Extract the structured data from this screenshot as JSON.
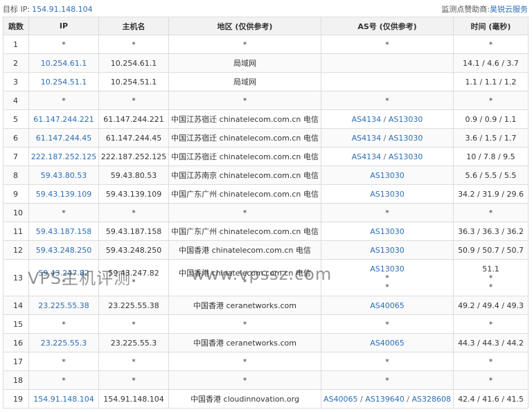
{
  "target": {
    "label": "目标 IP:",
    "ip": "154.91.148.104"
  },
  "sponsor": {
    "label": "监测点赞助商:",
    "name": "昊锐云服务"
  },
  "columns": [
    "跳数",
    "IP",
    "主机名",
    "地区 (仅供参考)",
    "AS号 (仅供参考)",
    "时间 (毫秒)"
  ],
  "rows": [
    {
      "hop": "1",
      "ip": "*",
      "host": "*",
      "region": "*",
      "as": [
        "*"
      ],
      "time": "*"
    },
    {
      "hop": "2",
      "ip": "10.254.61.1",
      "host": "10.254.61.1",
      "region": "局域网",
      "as": [],
      "time": "14.1 / 4.6 / 3.7"
    },
    {
      "hop": "3",
      "ip": "10.254.51.1",
      "host": "10.254.51.1",
      "region": "局域网",
      "as": [],
      "time": "1.1 / 1.1 / 1.2"
    },
    {
      "hop": "4",
      "ip": "*",
      "host": "*",
      "region": "*",
      "as": [
        "*"
      ],
      "time": "*"
    },
    {
      "hop": "5",
      "ip": "61.147.244.221",
      "host": "61.147.244.221",
      "region": "中国江苏宿迁 chinatelecom.com.cn 电信",
      "as": [
        "AS4134",
        "AS13030"
      ],
      "time": "0.9 / 0.9 / 1.1"
    },
    {
      "hop": "6",
      "ip": "61.147.244.45",
      "host": "61.147.244.45",
      "region": "中国江苏宿迁 chinatelecom.com.cn 电信",
      "as": [
        "AS4134",
        "AS13030"
      ],
      "time": "3.6 / 1.5 / 1.7"
    },
    {
      "hop": "7",
      "ip": "222.187.252.125",
      "host": "222.187.252.125",
      "region": "中国江苏宿迁 chinatelecom.com.cn 电信",
      "as": [
        "AS4134",
        "AS13030"
      ],
      "time": "10 / 7.8 / 9.5"
    },
    {
      "hop": "8",
      "ip": "59.43.80.53",
      "host": "59.43.80.53",
      "region": "中国江苏南京 chinatelecom.com.cn 电信",
      "as": [
        "AS13030"
      ],
      "time": "5.6 / 5.5 / 5.5"
    },
    {
      "hop": "9",
      "ip": "59.43.139.109",
      "host": "59.43.139.109",
      "region": "中国广东广州 chinatelecom.com.cn 电信",
      "as": [
        "AS13030"
      ],
      "time": "34.2 / 31.9 / 29.6"
    },
    {
      "hop": "10",
      "ip": "*",
      "host": "*",
      "region": "*",
      "as": [
        "*"
      ],
      "time": "*"
    },
    {
      "hop": "11",
      "ip": "59.43.187.158",
      "host": "59.43.187.158",
      "region": "中国广东广州 chinatelecom.com.cn 电信",
      "as": [
        "AS13030"
      ],
      "time": "36.3 / 36.3 / 36.2"
    },
    {
      "hop": "12",
      "ip": "59.43.248.250",
      "host": "59.43.248.250",
      "region": "中国香港 chinatelecom.com.cn 电信",
      "as": [
        "AS13030"
      ],
      "time": "50.9 / 50.7 / 50.7"
    },
    {
      "hop": "13",
      "tall": true,
      "ip": "59.43.247.82",
      "ip2": "*",
      "host": "59.43.247.82",
      "host2": "*",
      "region": "中国香港 chinatelecom.com.cn 电信",
      "region2": "*",
      "as": [
        "AS13030"
      ],
      "as2": "*",
      "as3": "*",
      "time": "51.1",
      "time2": "*",
      "time3": "*"
    },
    {
      "hop": "14",
      "ip": "23.225.55.38",
      "host": "23.225.55.38",
      "region": "中国香港 ceranetworks.com",
      "as": [
        "AS40065"
      ],
      "time": "49.2 / 49.4 / 49.3"
    },
    {
      "hop": "15",
      "ip": "*",
      "host": "*",
      "region": "*",
      "as": [
        "*"
      ],
      "time": "*"
    },
    {
      "hop": "16",
      "ip": "23.225.55.3",
      "host": "23.225.55.3",
      "region": "中国香港 ceranetworks.com",
      "as": [
        "AS40065"
      ],
      "time": "44.3 / 44.3 / 44.2"
    },
    {
      "hop": "17",
      "ip": "*",
      "host": "*",
      "region": "*",
      "as": [
        "*"
      ],
      "time": "*"
    },
    {
      "hop": "18",
      "ip": "*",
      "host": "*",
      "region": "*",
      "as": [
        "*"
      ],
      "time": "*"
    },
    {
      "hop": "19",
      "ip": "154.91.148.104",
      "host": "154.91.148.104",
      "region": "中国香港 cloudinnovation.org",
      "as": [
        "AS40065",
        "AS139640",
        "AS328608"
      ],
      "time": "42.4 / 41.6 / 41.5"
    }
  ],
  "watermark": {
    "left": "VPS主机评测",
    "right": "www.vpssz.com"
  },
  "colors": {
    "link": "#2a6db5",
    "header_bg": "#f2f2f2",
    "border": "#dcdcdc"
  }
}
